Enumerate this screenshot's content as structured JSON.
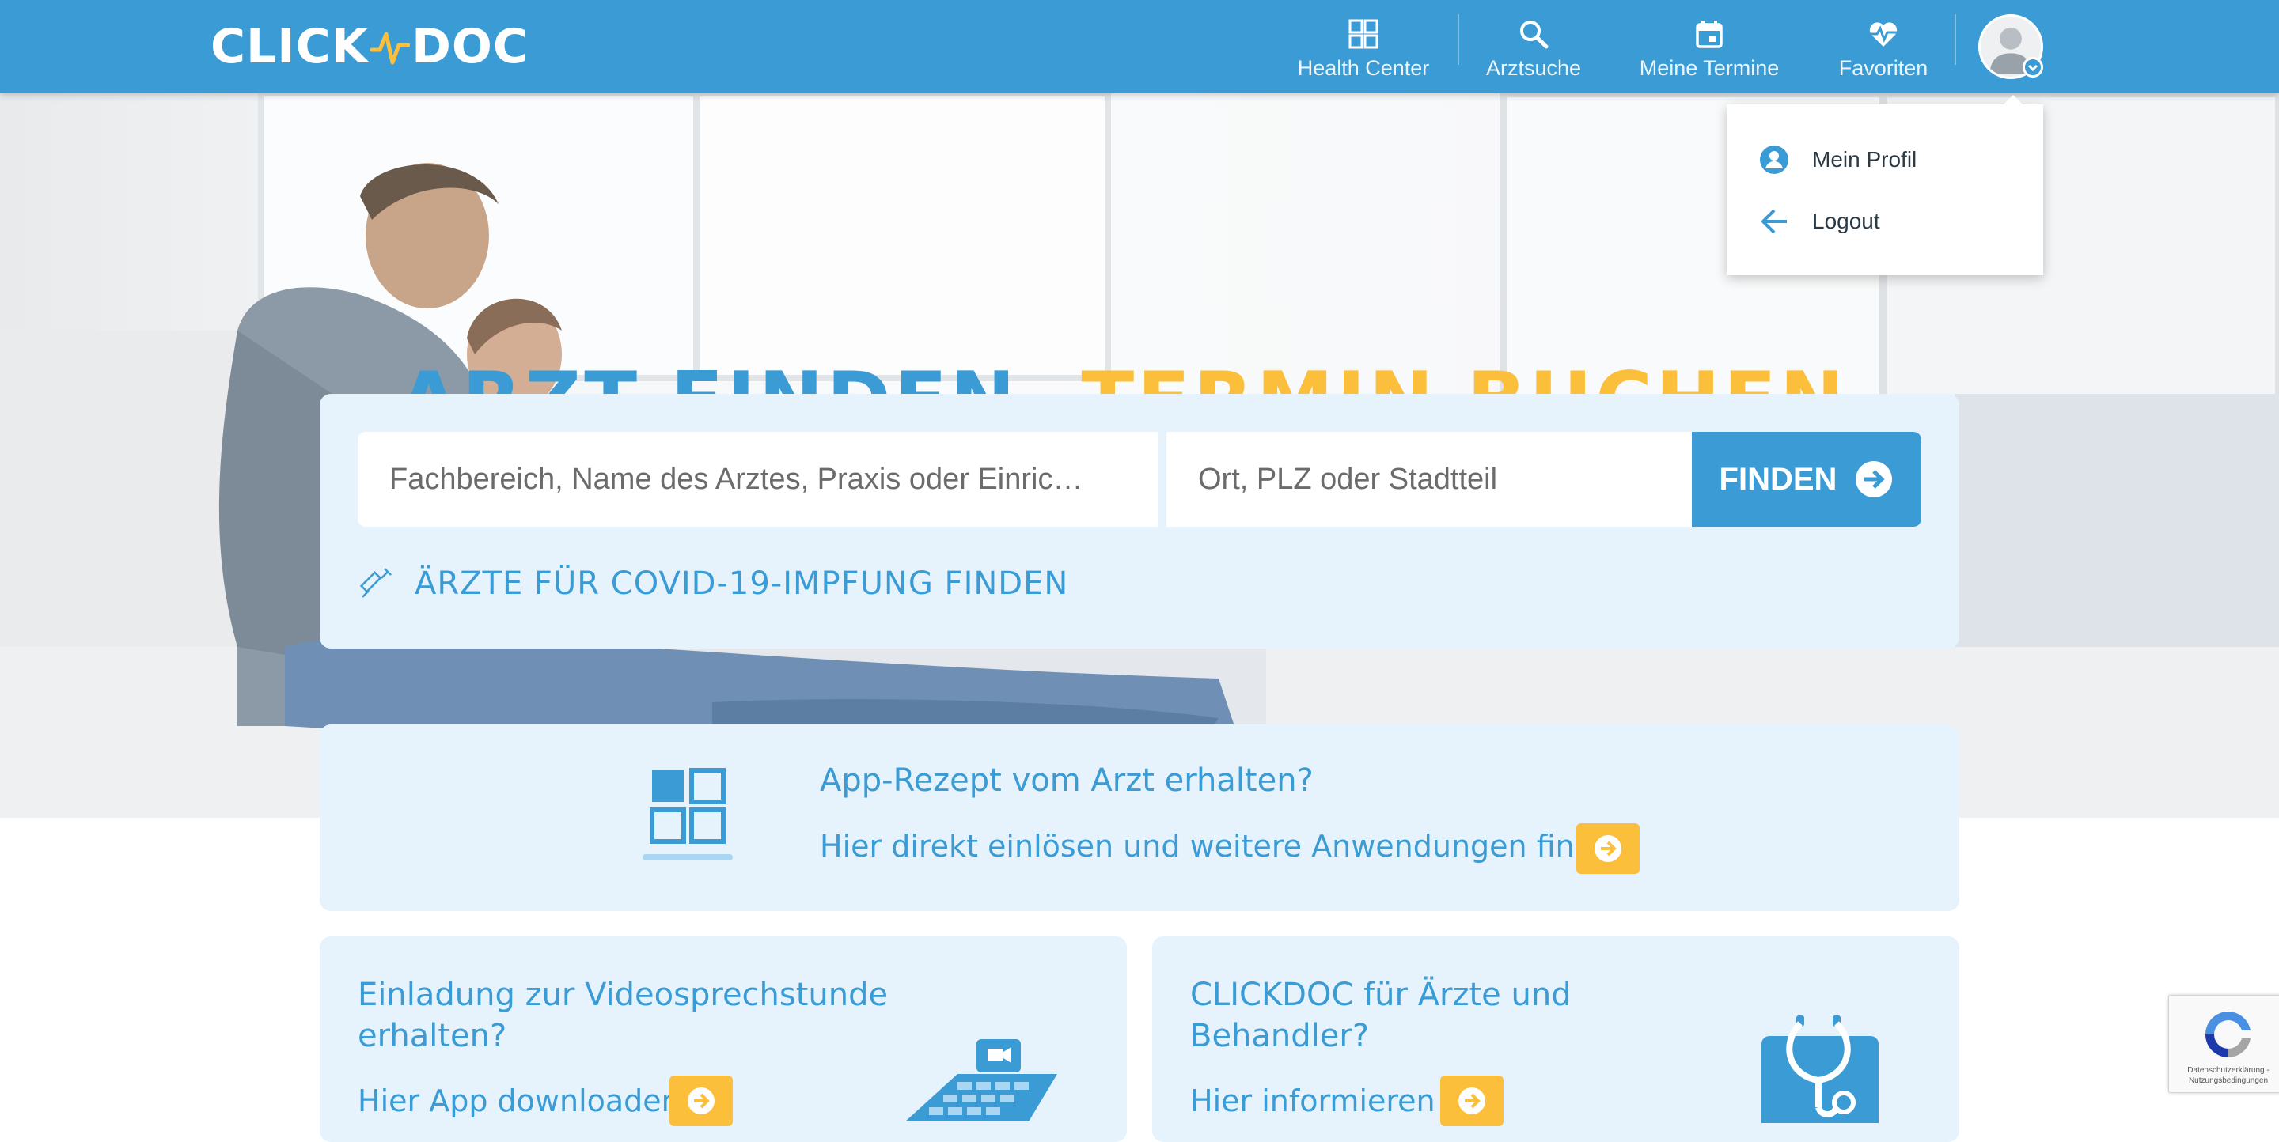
{
  "brand": {
    "name_left": "CLICK",
    "name_right": "DOC"
  },
  "nav": {
    "items": [
      {
        "label": "Health Center",
        "icon": "grid-icon"
      },
      {
        "label": "Arztsuche",
        "icon": "search-icon"
      },
      {
        "label": "Meine Termine",
        "icon": "calendar-icon"
      },
      {
        "label": "Favoriten",
        "icon": "heart-pulse-icon"
      }
    ]
  },
  "user_menu": {
    "items": [
      {
        "label": "Mein Profil",
        "icon": "user-circle-icon"
      },
      {
        "label": "Logout",
        "icon": "arrow-left-icon"
      }
    ]
  },
  "hero": {
    "headline_part1": "ARZT FINDEN",
    "headline_comma": ",",
    "headline_part2": "TERMIN BUCHEN."
  },
  "search": {
    "what_placeholder": "Fachbereich, Name des Arztes, Praxis oder Einric…",
    "where_placeholder": "Ort, PLZ oder Stadtteil",
    "find_label": "FINDEN",
    "covid_label": "ÄRZTE FÜR COVID-19-IMPFUNG FINDEN"
  },
  "app_card": {
    "title": "App-Rezept vom Arzt erhalten?",
    "subtitle": "Hier direkt einlösen und weitere Anwendungen finden"
  },
  "video_card": {
    "title": "Einladung zur Videosprechstunde erhalten?",
    "link": "Hier App downloaden"
  },
  "doctor_card": {
    "title": "CLICKDOC für Ärzte und Behandler?",
    "link": "Hier informieren"
  },
  "recaptcha": {
    "line1": "Datenschutzerklärung -",
    "line2": "Nutzungsbedingungen"
  },
  "colors": {
    "primary": "#3a9bd5",
    "accent": "#fbbf3b",
    "card_bg": "#e6f3fc",
    "text_dark": "#2b3a45"
  }
}
